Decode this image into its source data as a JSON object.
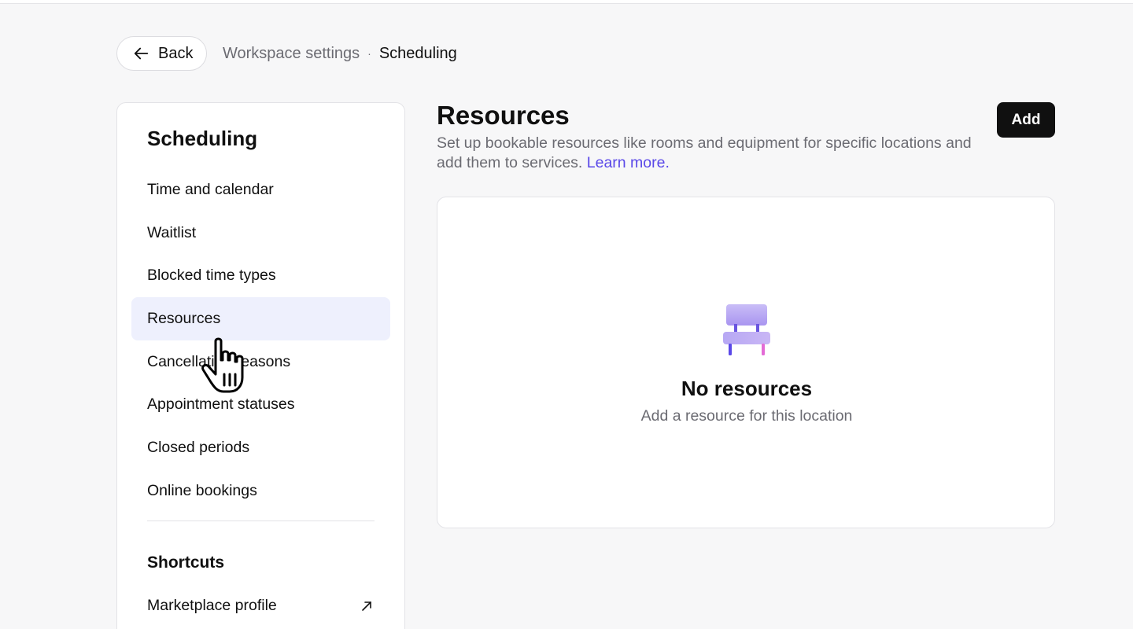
{
  "header": {
    "back_label": "Back",
    "breadcrumb": [
      "Workspace settings",
      "·",
      "Scheduling"
    ]
  },
  "sidebar": {
    "title": "Scheduling",
    "items": [
      {
        "label": "Time and calendar",
        "active": false
      },
      {
        "label": "Waitlist",
        "active": false
      },
      {
        "label": "Blocked time types",
        "active": false
      },
      {
        "label": "Resources",
        "active": true
      },
      {
        "label": "Cancellation reasons",
        "active": false
      },
      {
        "label": "Appointment statuses",
        "active": false
      },
      {
        "label": "Closed periods",
        "active": false
      },
      {
        "label": "Online bookings",
        "active": false
      }
    ],
    "shortcuts_title": "Shortcuts",
    "shortcuts": [
      {
        "label": "Marketplace profile",
        "icon": "external-link-icon"
      }
    ]
  },
  "main": {
    "title": "Resources",
    "description": "Set up bookable resources like rooms and equipment for specific locations and add them to services.",
    "learn_more": "Learn more.",
    "add_label": "Add",
    "empty_state": {
      "icon": "chair-icon",
      "title": "No resources",
      "subtitle": "Add a resource for this location"
    }
  },
  "colors": {
    "accent": "#5a48e8",
    "active_bg": "#eef0fd",
    "primary_button": "#101010",
    "page_bg": "#f7f7f8"
  }
}
